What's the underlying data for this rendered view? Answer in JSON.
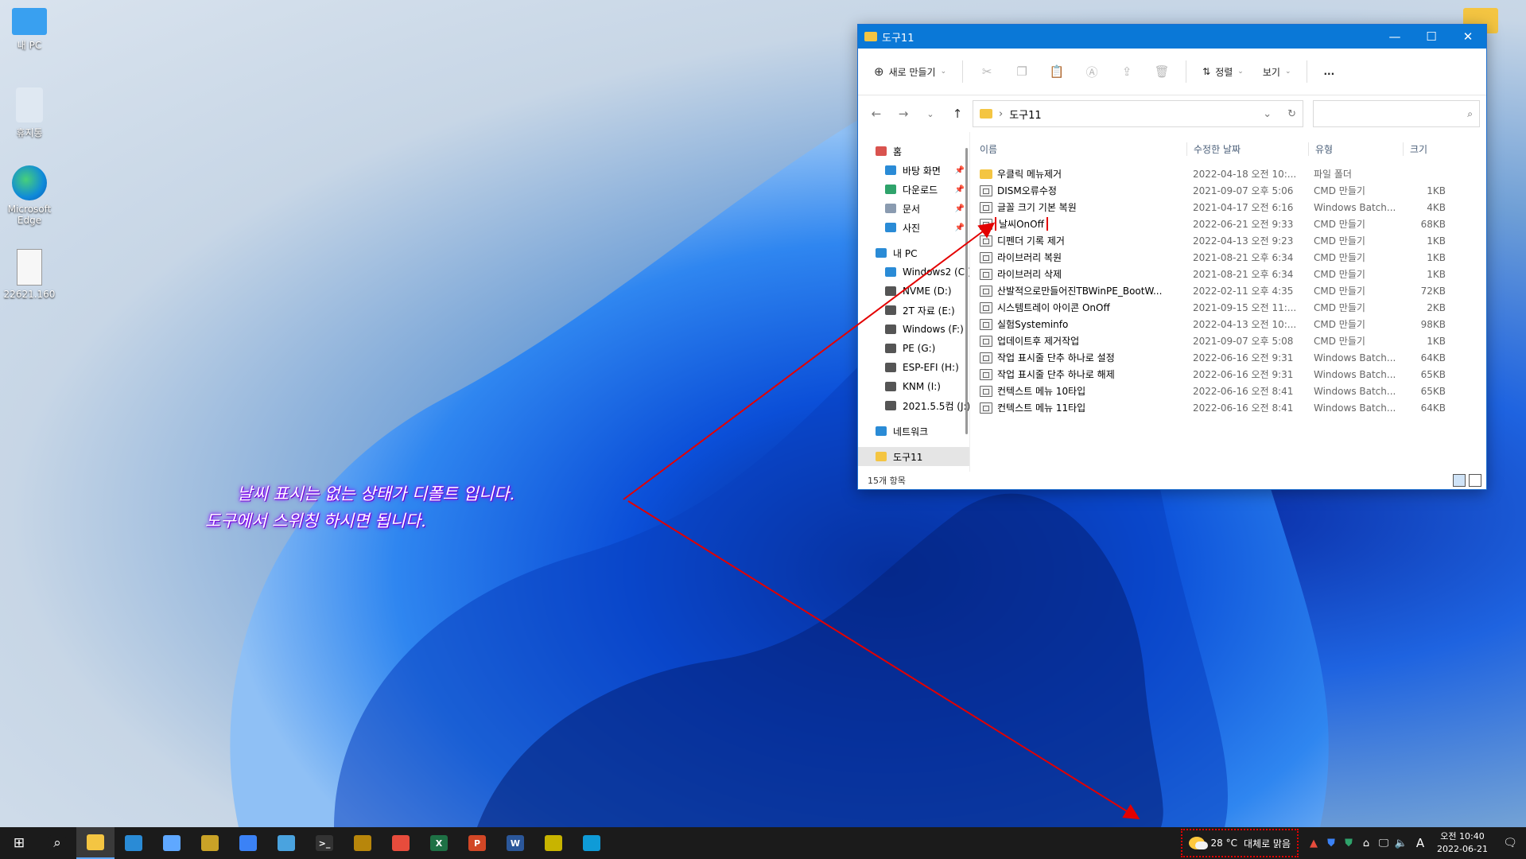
{
  "desktop": {
    "icons": [
      {
        "label": "내 PC"
      },
      {
        "label": "휴지통"
      },
      {
        "label": "Microsoft Edge"
      },
      {
        "label": "22621.160"
      }
    ]
  },
  "window": {
    "title": "도구11",
    "controls": {
      "minimize": "—",
      "maximize": "☐",
      "close": "✕"
    },
    "toolbar": {
      "new_label": "새로 만들기",
      "sort_label": "정렬",
      "view_label": "보기",
      "more_label": "..."
    },
    "address": {
      "path": "도구11",
      "search_placeholder": ""
    },
    "nav": [
      {
        "label": "홈",
        "color": "#d9534f",
        "pinned": false
      },
      {
        "label": "바탕 화면",
        "color": "#2a8bd6",
        "pinned": true
      },
      {
        "label": "다운로드",
        "color": "#2fa36b",
        "pinned": true
      },
      {
        "label": "문서",
        "color": "#8a9bb0",
        "pinned": true
      },
      {
        "label": "사진",
        "color": "#2a8bd6",
        "pinned": true
      },
      {
        "label": "내 PC",
        "color": "#2a8bd6",
        "pinned": false
      },
      {
        "label": "Windows2 (C:)",
        "color": "#2a8bd6",
        "pinned": false
      },
      {
        "label": "NVME (D:)",
        "color": "#555555",
        "pinned": false
      },
      {
        "label": "2T 자료 (E:)",
        "color": "#555555",
        "pinned": false
      },
      {
        "label": "Windows (F:)",
        "color": "#555555",
        "pinned": false
      },
      {
        "label": "PE (G:)",
        "color": "#555555",
        "pinned": false
      },
      {
        "label": "ESP-EFI (H:)",
        "color": "#555555",
        "pinned": false
      },
      {
        "label": "KNM (I:)",
        "color": "#555555",
        "pinned": false
      },
      {
        "label": "2021.5.5컴 (J:)",
        "color": "#555555",
        "pinned": false
      },
      {
        "label": "네트워크",
        "color": "#2a8bd6",
        "pinned": false
      },
      {
        "label": "도구11",
        "color": "#f4c542",
        "pinned": false
      }
    ],
    "columns": {
      "name": "이름",
      "date": "수정한 날짜",
      "type": "유형",
      "size": "크기"
    },
    "files": [
      {
        "name": "우클릭 메뉴제거",
        "date": "2022-04-18 오전 10:...",
        "type": "파일 폴더",
        "size": "",
        "folder": true
      },
      {
        "name": "DISM오류수정",
        "date": "2021-09-07 오후 5:06",
        "type": "CMD 만들기",
        "size": "1KB"
      },
      {
        "name": "글꼴 크기 기본 복원",
        "date": "2021-04-17 오전 6:16",
        "type": "Windows Batch...",
        "size": "4KB"
      },
      {
        "name": "날씨OnOff",
        "date": "2022-06-21 오전 9:33",
        "type": "CMD 만들기",
        "size": "68KB",
        "highlight": true
      },
      {
        "name": "디펜더 기록 제거",
        "date": "2022-04-13 오전 9:23",
        "type": "CMD 만들기",
        "size": "1KB"
      },
      {
        "name": "라이브러리 복원",
        "date": "2021-08-21 오후 6:34",
        "type": "CMD 만들기",
        "size": "1KB"
      },
      {
        "name": "라이브러리 삭제",
        "date": "2021-08-21 오후 6:34",
        "type": "CMD 만들기",
        "size": "1KB"
      },
      {
        "name": "산발적으로만들어진TBWinPE_BootW...",
        "date": "2022-02-11 오후 4:35",
        "type": "CMD 만들기",
        "size": "72KB"
      },
      {
        "name": "시스템트레이 아이콘 OnOff",
        "date": "2021-09-15 오전 11:...",
        "type": "CMD 만들기",
        "size": "2KB"
      },
      {
        "name": "실험Systeminfo",
        "date": "2022-04-13 오전 10:...",
        "type": "CMD 만들기",
        "size": "98KB"
      },
      {
        "name": "업데이트후 제거작업",
        "date": "2021-09-07 오후 5:08",
        "type": "CMD 만들기",
        "size": "1KB"
      },
      {
        "name": "작업 표시줄 단추 하나로 설정",
        "date": "2022-06-16 오전 9:31",
        "type": "Windows Batch...",
        "size": "64KB"
      },
      {
        "name": "작업 표시줄 단추 하나로 해제",
        "date": "2022-06-16 오전 9:31",
        "type": "Windows Batch...",
        "size": "65KB"
      },
      {
        "name": "컨텍스트 메뉴 10타입",
        "date": "2022-06-16 오전 8:41",
        "type": "Windows Batch...",
        "size": "65KB"
      },
      {
        "name": "컨텍스트 메뉴 11타입",
        "date": "2022-06-16 오전 8:41",
        "type": "Windows Batch...",
        "size": "64KB"
      }
    ],
    "status": "15개 항목"
  },
  "annotation": {
    "line1": "날씨 표시는 없는 상태가 디폴트 입니다.",
    "line2": "도구에서 스위칭 하시면 됩니다.",
    "color": "#8a00ff"
  },
  "taskbar": {
    "apps": [
      {
        "name": "start-icon",
        "glyph": "⊞",
        "color": "#1b1b1b"
      },
      {
        "name": "search-icon",
        "glyph": "⌕",
        "color": "#1b1b1b"
      },
      {
        "name": "file-explorer-icon",
        "glyph": "",
        "color": "#f4c542",
        "active": true
      },
      {
        "name": "app-blue-icon",
        "glyph": "",
        "color": "#2a8bd6"
      },
      {
        "name": "monitor-app-icon",
        "glyph": "",
        "color": "#5fa8ff"
      },
      {
        "name": "lock-app-icon",
        "glyph": "",
        "color": "#c9a227"
      },
      {
        "name": "store-icon",
        "glyph": "",
        "color": "#3b82f6"
      },
      {
        "name": "notepad-icon",
        "glyph": "",
        "color": "#4aa3df"
      },
      {
        "name": "terminal-icon",
        "glyph": ">_",
        "color": "#333333"
      },
      {
        "name": "tool-app-icon",
        "glyph": "",
        "color": "#b8860b"
      },
      {
        "name": "snip-app-icon",
        "glyph": "",
        "color": "#e74c3c"
      },
      {
        "name": "excel-icon",
        "glyph": "X",
        "color": "#1e7145"
      },
      {
        "name": "powerpoint-icon",
        "glyph": "P",
        "color": "#d24726"
      },
      {
        "name": "word-icon",
        "glyph": "W",
        "color": "#2b579a"
      },
      {
        "name": "pe-app-icon",
        "glyph": "",
        "color": "#c8b400"
      },
      {
        "name": "edge-icon",
        "glyph": "",
        "color": "#0f9bd7"
      }
    ],
    "weather": {
      "temp": "28 °C",
      "desc": "대체로 맑음"
    },
    "ime": "A",
    "clock": {
      "time": "오전 10:40",
      "date": "2022-06-21"
    }
  }
}
